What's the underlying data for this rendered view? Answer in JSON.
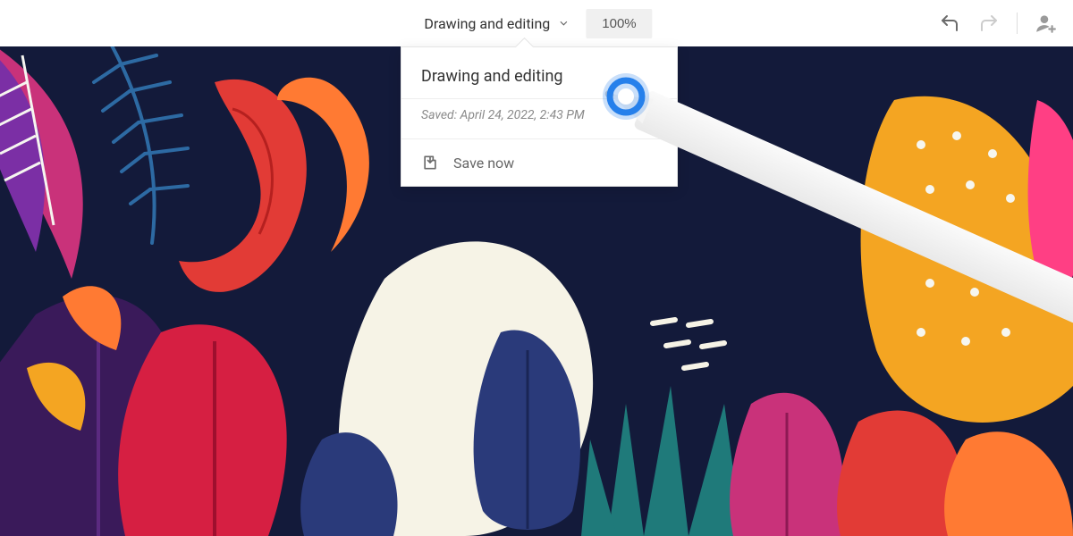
{
  "toolbar": {
    "title": "Drawing and editing",
    "zoom": "100%"
  },
  "popover": {
    "title": "Drawing and editing",
    "saved_text": "Saved: April 24, 2022, 2:43 PM",
    "save_now": "Save now"
  },
  "colors": {
    "canvas_bg": "#131a3a",
    "accent": "#2680eb"
  }
}
